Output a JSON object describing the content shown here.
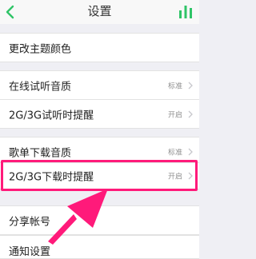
{
  "header": {
    "title": "设置"
  },
  "rows": [
    {
      "label": "更改主题颜色",
      "value": ""
    },
    {
      "label": "在线试听音质",
      "value": "标准"
    },
    {
      "label": "2G/3G试听时提醒",
      "value": "开启"
    },
    {
      "label": "歌单下载音质",
      "value": "标准"
    },
    {
      "label": "2G/3G下载时提醒",
      "value": "开启"
    },
    {
      "label": "分享帐号",
      "value": ""
    },
    {
      "label": "通知设置",
      "value": ""
    }
  ],
  "colors": {
    "accent_green": "#2fc467",
    "highlight": "#ff1a7a",
    "header_bg": "#f8f8f8",
    "page_bg": "#efeff4"
  },
  "icons": {
    "back": "chevron-left-icon",
    "equalizer": "equalizer-icon",
    "row_chevron": "chevron-right-icon"
  }
}
